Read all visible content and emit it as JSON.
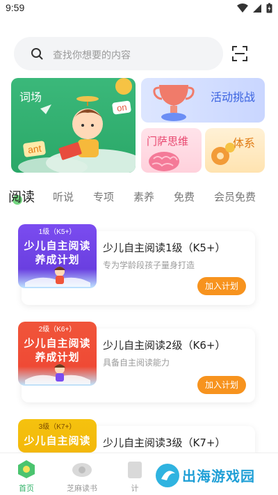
{
  "status_bar": {
    "time": "9:59"
  },
  "search": {
    "placeholder": "查找你想要的内容"
  },
  "banners": {
    "words": "词场",
    "words_badges": [
      "on",
      "ant"
    ],
    "challenge": "活动挑战",
    "mensa": "门萨思维",
    "system": "体系"
  },
  "tabs": [
    "阅读",
    "听说",
    "专项",
    "素养",
    "免费",
    "会员免费"
  ],
  "books": [
    {
      "level_badge": "1级（K5+）",
      "cover_line1": "少儿自主阅读",
      "cover_line2": "养成计划",
      "title": "少儿自主阅读1级（K5+）",
      "subtitle": "专为学龄段孩子量身打造",
      "button": "加入计划",
      "color": "#7b4cf0"
    },
    {
      "level_badge": "2级（K6+）",
      "cover_line1": "少儿自主阅读",
      "cover_line2": "养成计划",
      "title": "少儿自主阅读2级（K6+）",
      "subtitle": "具备自主阅读能力",
      "button": "加入计划",
      "color": "#f0553a"
    },
    {
      "level_badge": "3级（K7+）",
      "cover_line1": "少儿自主阅读",
      "cover_line2": "",
      "title": "少儿自主阅读3级（K7+）",
      "subtitle": "",
      "button": "",
      "color": "#f5c20f"
    }
  ],
  "bottom_nav": [
    "首页",
    "芝麻读书",
    "计"
  ],
  "watermark": "出海游戏园",
  "colors": {
    "accent_green": "#34b36a",
    "accent_orange": "#f7931e"
  }
}
